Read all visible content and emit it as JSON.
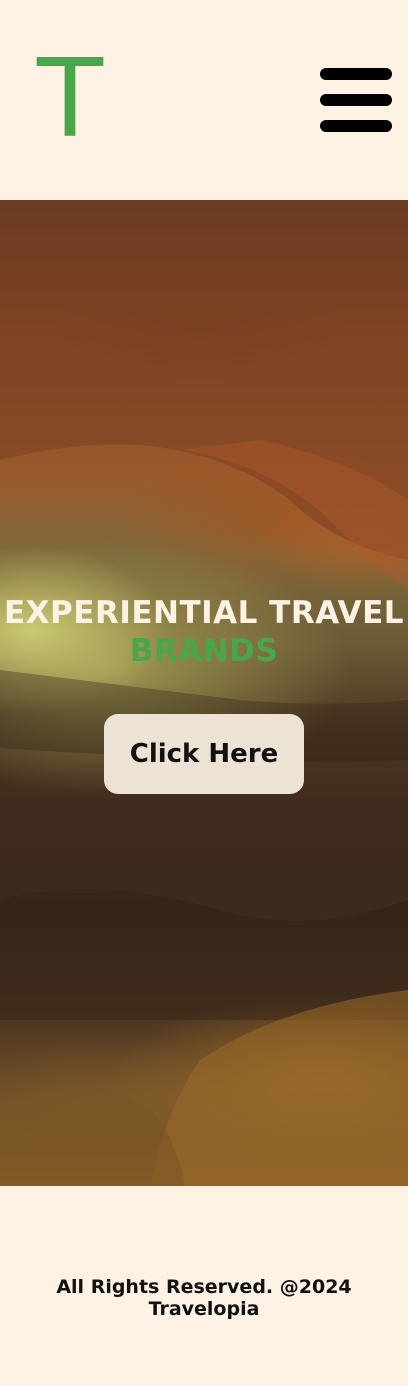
{
  "header": {
    "logo_letter": "T",
    "menu_icon": "hamburger-menu-icon"
  },
  "hero": {
    "title": "EXPERIENTIAL TRAVEL",
    "subtitle": "BRANDS",
    "cta_label": "Click Here"
  },
  "footer": {
    "copyright": "All Rights Reserved. @2024 Travelopia"
  },
  "colors": {
    "background": "#fdf2e3",
    "brand_green": "#4aa64b",
    "button_bg": "#ede3d4",
    "text_dark": "#111111"
  }
}
